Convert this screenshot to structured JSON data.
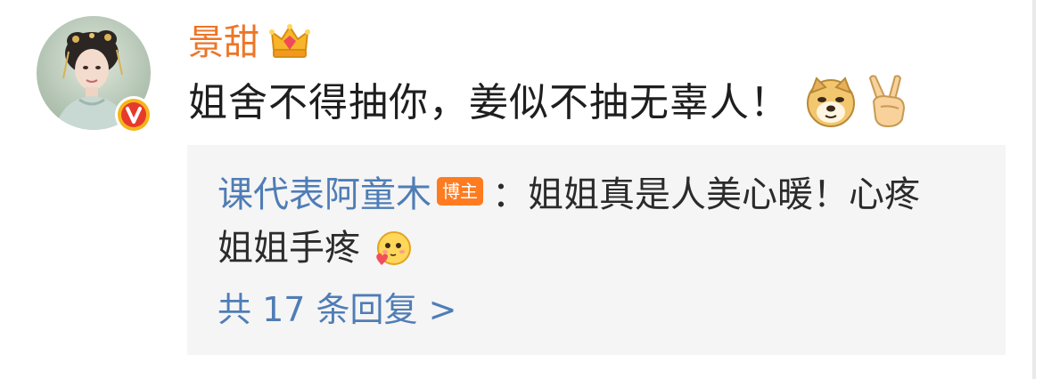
{
  "comment": {
    "username": "景甜",
    "text": "姐舍不得抽你，姜似不抽无辜人！",
    "emojis": [
      "doge-emoji",
      "victory-hand-emoji"
    ],
    "crown_icon": "crown-icon",
    "verified_icon": "verified-v-badge-icon"
  },
  "reply": {
    "author": "课代表阿童木",
    "badge": "博主",
    "colon": "：",
    "content_line1": "姐姐真是人美心暖！心疼",
    "content_line2": "姐姐手疼",
    "emoji": "love-face-emoji"
  },
  "view_replies": "共 17 条回复 >",
  "colors": {
    "username": "#ec7628",
    "link": "#4f7db6",
    "badge": "#ff7b20",
    "reply_bg": "#f5f5f5"
  }
}
